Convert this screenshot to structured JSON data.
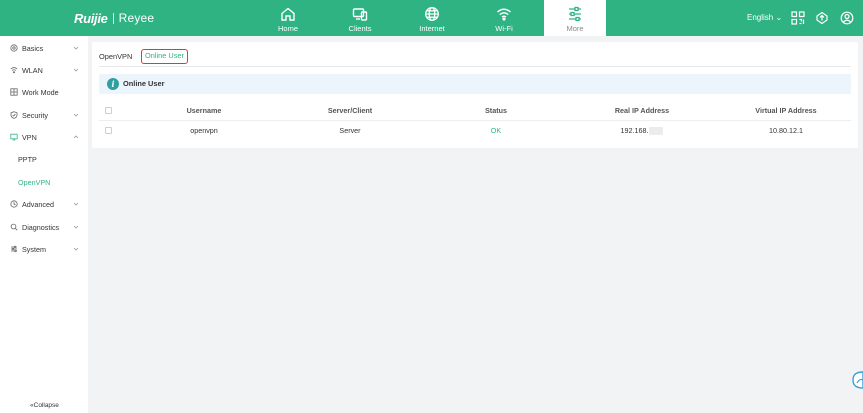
{
  "brand": {
    "primary": "Ruijie",
    "secondary": "Reyee",
    "color": "#2fb383"
  },
  "topnav": [
    {
      "label": "Home",
      "icon": "home-icon"
    },
    {
      "label": "Clients",
      "icon": "clients-icon"
    },
    {
      "label": "Internet",
      "icon": "globe-icon"
    },
    {
      "label": "Wi-Fi",
      "icon": "wifi-icon"
    },
    {
      "label": "More",
      "icon": "sliders-icon",
      "active": true
    }
  ],
  "header": {
    "language": "English",
    "language_caret": "⌄"
  },
  "sidebar": {
    "items": [
      {
        "label": "Basics",
        "icon": "gear-icon",
        "expanded": false
      },
      {
        "label": "WLAN",
        "icon": "wifi-icon",
        "expanded": false
      },
      {
        "label": "Work Mode",
        "icon": "grid-icon"
      },
      {
        "label": "Security",
        "icon": "shield-icon",
        "expanded": false
      },
      {
        "label": "VPN",
        "icon": "vpn-icon",
        "expanded": true
      }
    ],
    "vpn_subitems": [
      {
        "label": "PPTP"
      },
      {
        "label": "OpenVPN",
        "active": true
      }
    ],
    "items_after": [
      {
        "label": "Advanced",
        "icon": "advanced-icon",
        "expanded": false
      },
      {
        "label": "Diagnostics",
        "icon": "diagnostics-icon",
        "expanded": false
      },
      {
        "label": "System",
        "icon": "system-icon",
        "expanded": false
      }
    ],
    "collapse_label": "Collapse"
  },
  "main": {
    "tabs": [
      {
        "label": "OpenVPN"
      },
      {
        "label": "Online User",
        "active": true
      }
    ],
    "info_title": "Online User",
    "table": {
      "columns": [
        "Username",
        "Server/Client",
        "Status",
        "Real IP Address",
        "Virtual IP Address"
      ],
      "rows": [
        {
          "username": "openvpn",
          "role": "Server",
          "status": "OK",
          "real_ip": "192.168.",
          "virtual_ip": "10.80.12.1"
        }
      ]
    }
  }
}
